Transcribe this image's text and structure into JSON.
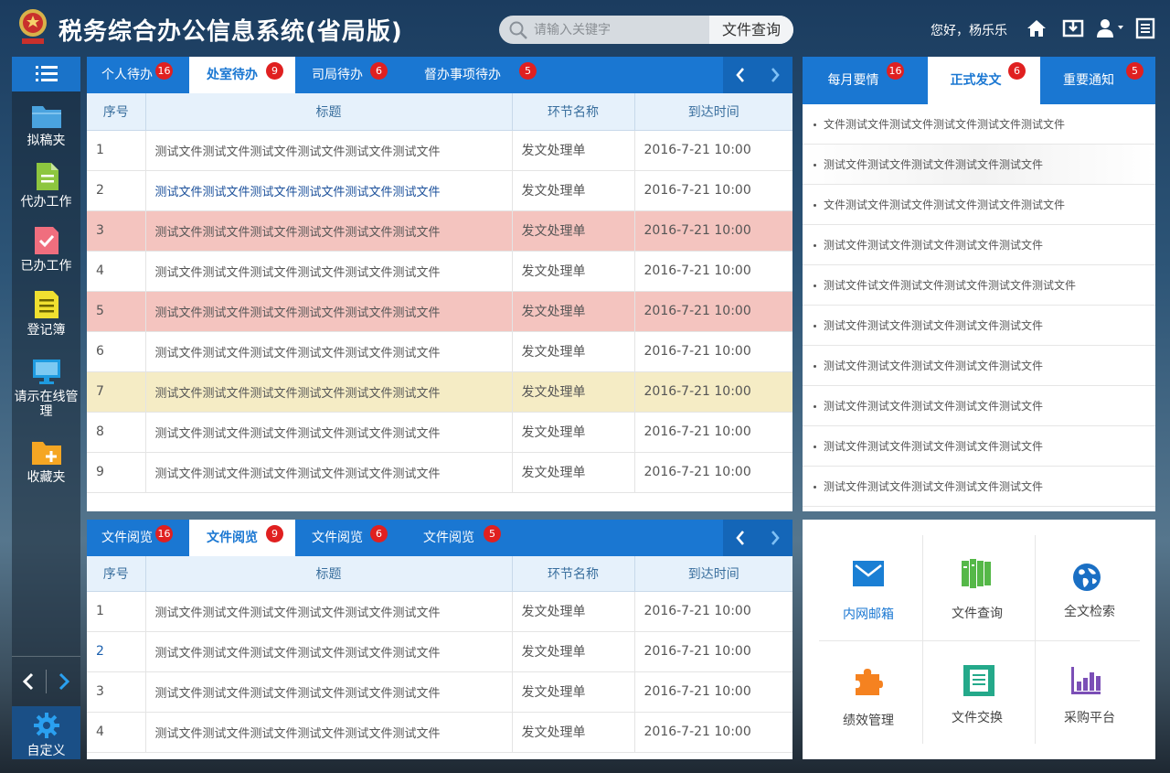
{
  "header": {
    "title": "税务综合办公信息系统(省局版)",
    "search_placeholder": "请输入关键字",
    "search_button": "文件查询",
    "greeting": "您好，杨乐乐"
  },
  "sidebar": {
    "items": [
      {
        "label": "拟稿夹",
        "color": "#4aa3df"
      },
      {
        "label": "代办工作",
        "color": "#8dc63f"
      },
      {
        "label": "已办工作",
        "color": "#f06e7e"
      },
      {
        "label": "登记簿",
        "color": "#f0e030"
      },
      {
        "label": "请示在线管理",
        "color": "#1f9be0"
      },
      {
        "label": "收藏夹",
        "color": "#f5a623"
      }
    ],
    "custom_label": "自定义"
  },
  "todo_panel": {
    "tabs": [
      {
        "label": "个人待办",
        "badge": "16"
      },
      {
        "label": "处室待办",
        "badge": "9"
      },
      {
        "label": "司局待办",
        "badge": "6"
      },
      {
        "label": "督办事项待办",
        "badge": "5"
      }
    ],
    "columns": [
      "序号",
      "标题",
      "环节名称",
      "到达时间"
    ],
    "rows": [
      {
        "no": "1",
        "title": "测试文件测试文件测试文件测试文件测试文件测试文件",
        "step": "发文处理单",
        "time": "2016-7-21 10:00"
      },
      {
        "no": "2",
        "title": "测试文件测试文件测试文件测试文件测试文件测试文件",
        "step": "发文处理单",
        "time": "2016-7-21 10:00"
      },
      {
        "no": "3",
        "title": "测试文件测试文件测试文件测试文件测试文件测试文件",
        "step": "发文处理单",
        "time": "2016-7-21 10:00"
      },
      {
        "no": "4",
        "title": "测试文件测试文件测试文件测试文件测试文件测试文件",
        "step": "发文处理单",
        "time": "2016-7-21 10:00"
      },
      {
        "no": "5",
        "title": "测试文件测试文件测试文件测试文件测试文件测试文件",
        "step": "发文处理单",
        "time": "2016-7-21 10:00"
      },
      {
        "no": "6",
        "title": "测试文件测试文件测试文件测试文件测试文件测试文件",
        "step": "发文处理单",
        "time": "2016-7-21 10:00"
      },
      {
        "no": "7",
        "title": "测试文件测试文件测试文件测试文件测试文件测试文件",
        "step": "发文处理单",
        "time": "2016-7-21 10:00"
      },
      {
        "no": "8",
        "title": "测试文件测试文件测试文件测试文件测试文件测试文件",
        "step": "发文处理单",
        "time": "2016-7-21 10:00"
      },
      {
        "no": "9",
        "title": "测试文件测试文件测试文件测试文件测试文件测试文件",
        "step": "发文处理单",
        "time": "2016-7-21 10:00"
      }
    ]
  },
  "read_panel": {
    "tabs": [
      {
        "label": "文件阅览",
        "badge": "16"
      },
      {
        "label": "文件阅览",
        "badge": "9"
      },
      {
        "label": "文件阅览",
        "badge": "6"
      },
      {
        "label": "文件阅览",
        "badge": "5"
      }
    ],
    "columns": [
      "序号",
      "标题",
      "环节名称",
      "到达时间"
    ],
    "rows": [
      {
        "no": "1",
        "title": "测试文件测试文件测试文件测试文件测试文件测试文件",
        "step": "发文处理单",
        "time": "2016-7-21 10:00"
      },
      {
        "no": "2",
        "title": "测试文件测试文件测试文件测试文件测试文件测试文件",
        "step": "发文处理单",
        "time": "2016-7-21 10:00"
      },
      {
        "no": "3",
        "title": "测试文件测试文件测试文件测试文件测试文件测试文件",
        "step": "发文处理单",
        "time": "2016-7-21 10:00"
      },
      {
        "no": "4",
        "title": "测试文件测试文件测试文件测试文件测试文件测试文件",
        "step": "发文处理单",
        "time": "2016-7-21 10:00"
      }
    ]
  },
  "news_panel": {
    "tabs": [
      {
        "label": "每月要情",
        "badge": "16"
      },
      {
        "label": "正式发文",
        "badge": "6"
      },
      {
        "label": "重要通知",
        "badge": "5"
      }
    ],
    "items": [
      "文件测试文件测试文件测试文件测试文件测试文件",
      "测试文件测试文件测试文件测试文件测试文件",
      "文件测试文件测试文件测试文件测试文件测试文件",
      "测试文件测试文件测试文件测试文件测试文件",
      "测试文件试文件测试文件测试文件测试文件测试文件",
      "测试文件测试文件测试文件测试文件测试文件",
      "测试文件测试文件测试文件测试文件测试文件",
      "测试文件测试文件测试文件测试文件测试文件",
      "测试文件测试文件测试文件测试文件测试文件",
      "测试文件测试文件测试文件测试文件测试文件"
    ]
  },
  "quick_links": [
    {
      "label": "内网邮箱"
    },
    {
      "label": "文件查询"
    },
    {
      "label": "全文检索"
    },
    {
      "label": "绩效管理"
    },
    {
      "label": "文件交换"
    },
    {
      "label": "采购平台"
    }
  ]
}
